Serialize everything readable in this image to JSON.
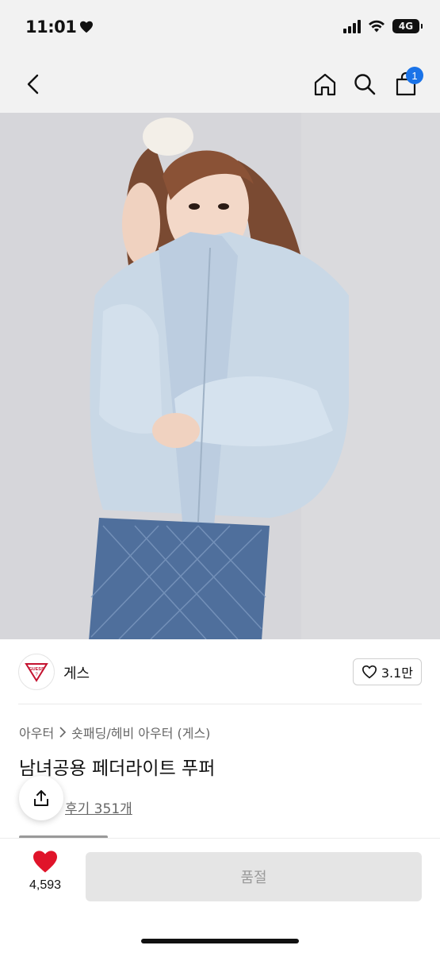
{
  "status": {
    "time": "11:01",
    "network": "4G"
  },
  "nav": {
    "cart_count": "1"
  },
  "hero": {
    "alt": "product photo"
  },
  "brand": {
    "name": "게스",
    "logo_text": "GUESS",
    "likes": "3.1만"
  },
  "breadcrumb": {
    "category": "아우터",
    "sub_category": "숏패딩/헤비 아우터 (게스)"
  },
  "product": {
    "title": "남녀공용 페더라이트 푸퍼",
    "review_label": "후기 351개"
  },
  "bottom": {
    "wish_count": "4,593",
    "soldout_label": "품절"
  },
  "colors": {
    "accent": "#1a73e8",
    "heart": "#e0142a",
    "disabled_bg": "#e5e5e5"
  }
}
